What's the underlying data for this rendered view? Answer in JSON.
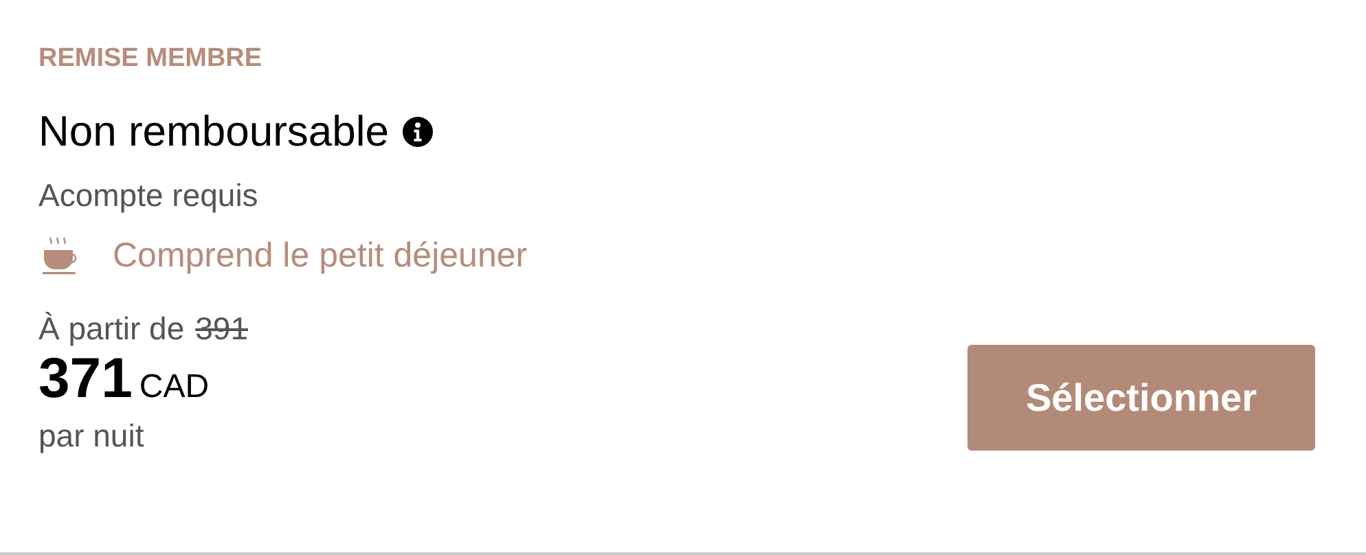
{
  "offer": {
    "tag": "REMISE MEMBRE",
    "title": "Non remboursable",
    "deposit": "Acompte requis",
    "perk": "Comprend le petit déjeuner"
  },
  "price": {
    "from_label": "À partir de",
    "original": "391",
    "amount": "371",
    "currency": "CAD",
    "unit": "par nuit"
  },
  "button": "Sélectionner"
}
